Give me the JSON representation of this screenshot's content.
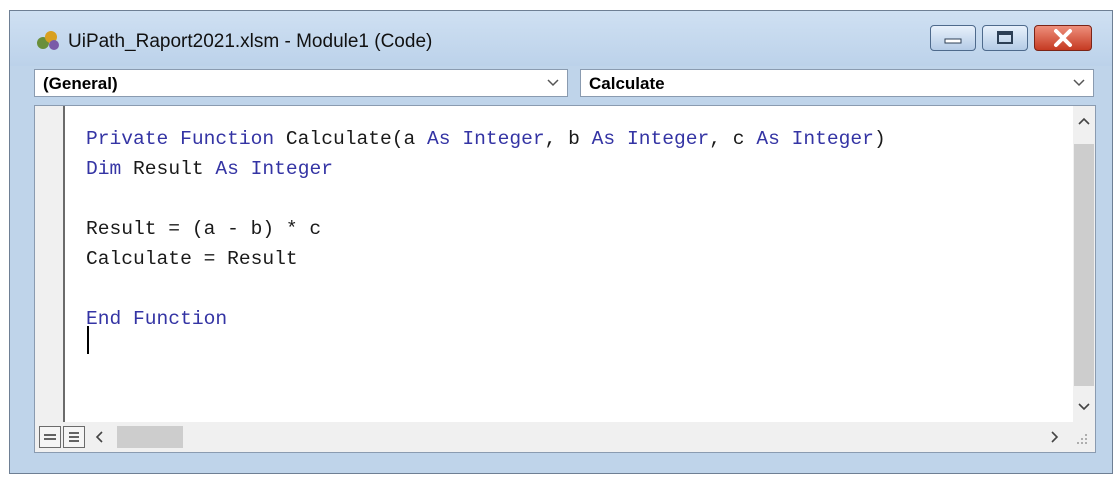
{
  "window": {
    "title": "UiPath_Raport2021.xlsm - Module1 (Code)"
  },
  "dropdowns": {
    "object": "(General)",
    "procedure": "Calculate"
  },
  "code_lines": [
    "Private Function Calculate(a As Integer, b As Integer, c As Integer)",
    "Dim Result As Integer",
    "",
    "Result = (a - b) * c",
    "Calculate = Result",
    "",
    "End Function"
  ],
  "colors": {
    "keyword": "#3434a4",
    "text": "#1a1a1a",
    "close_button": "#c53a22",
    "titlebar": "#bfd4ea"
  }
}
